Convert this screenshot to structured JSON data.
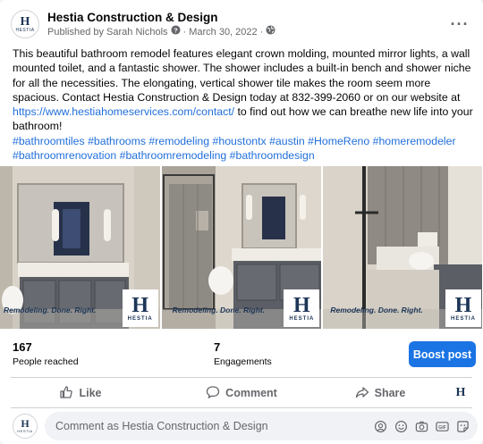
{
  "post": {
    "page_name": "Hestia Construction & Design",
    "published_by": "Published by Sarah Nichols",
    "date": "March 30, 2022",
    "separator": "·",
    "body_1": "This beautiful bathroom remodel features elegant crown molding, mounted mirror lights, a wall mounted toilet, and a fantastic shower. The shower includes a built-in bench and shower niche for all the necessities. The elongating, vertical shower tile makes the room seem more spacious. Contact Hestia Construction & Design today at 832-399-2060 or on our website at ",
    "link": "https://www.hestiahomeservices.com/contact/",
    "body_2": " to find out how we can breathe new life into your bathroom!",
    "hashtags_1": "#bathroomtiles #bathrooms #remodeling #houstontx #austin #HomeReno #homeremodeler",
    "hashtags_2": "#bathroomrenovation #bathroomremodeling #bathroomdesign"
  },
  "logo": {
    "mark": "H",
    "word": "HESTIA"
  },
  "photos": [
    {
      "caption": "Remodeling. Done. Right.",
      "brand": "HESTIA",
      "mark": "H"
    },
    {
      "caption": "Remodeling. Done. Right.",
      "brand": "HESTIA",
      "mark": "H"
    },
    {
      "caption": "Remodeling. Done. Right.",
      "brand": "HESTIA",
      "mark": "H"
    }
  ],
  "stats": {
    "reached_value": "167",
    "reached_label": "People reached",
    "engagements_value": "7",
    "engagements_label": "Engagements",
    "boost_label": "Boost post"
  },
  "actions": {
    "like": "Like",
    "comment": "Comment",
    "share": "Share"
  },
  "composer": {
    "placeholder": "Comment as Hestia Construction & Design"
  },
  "colors": {
    "link": "#216fdb",
    "boost": "#1b74e4",
    "muted": "#65676b",
    "brand_navy": "#1d3557"
  }
}
